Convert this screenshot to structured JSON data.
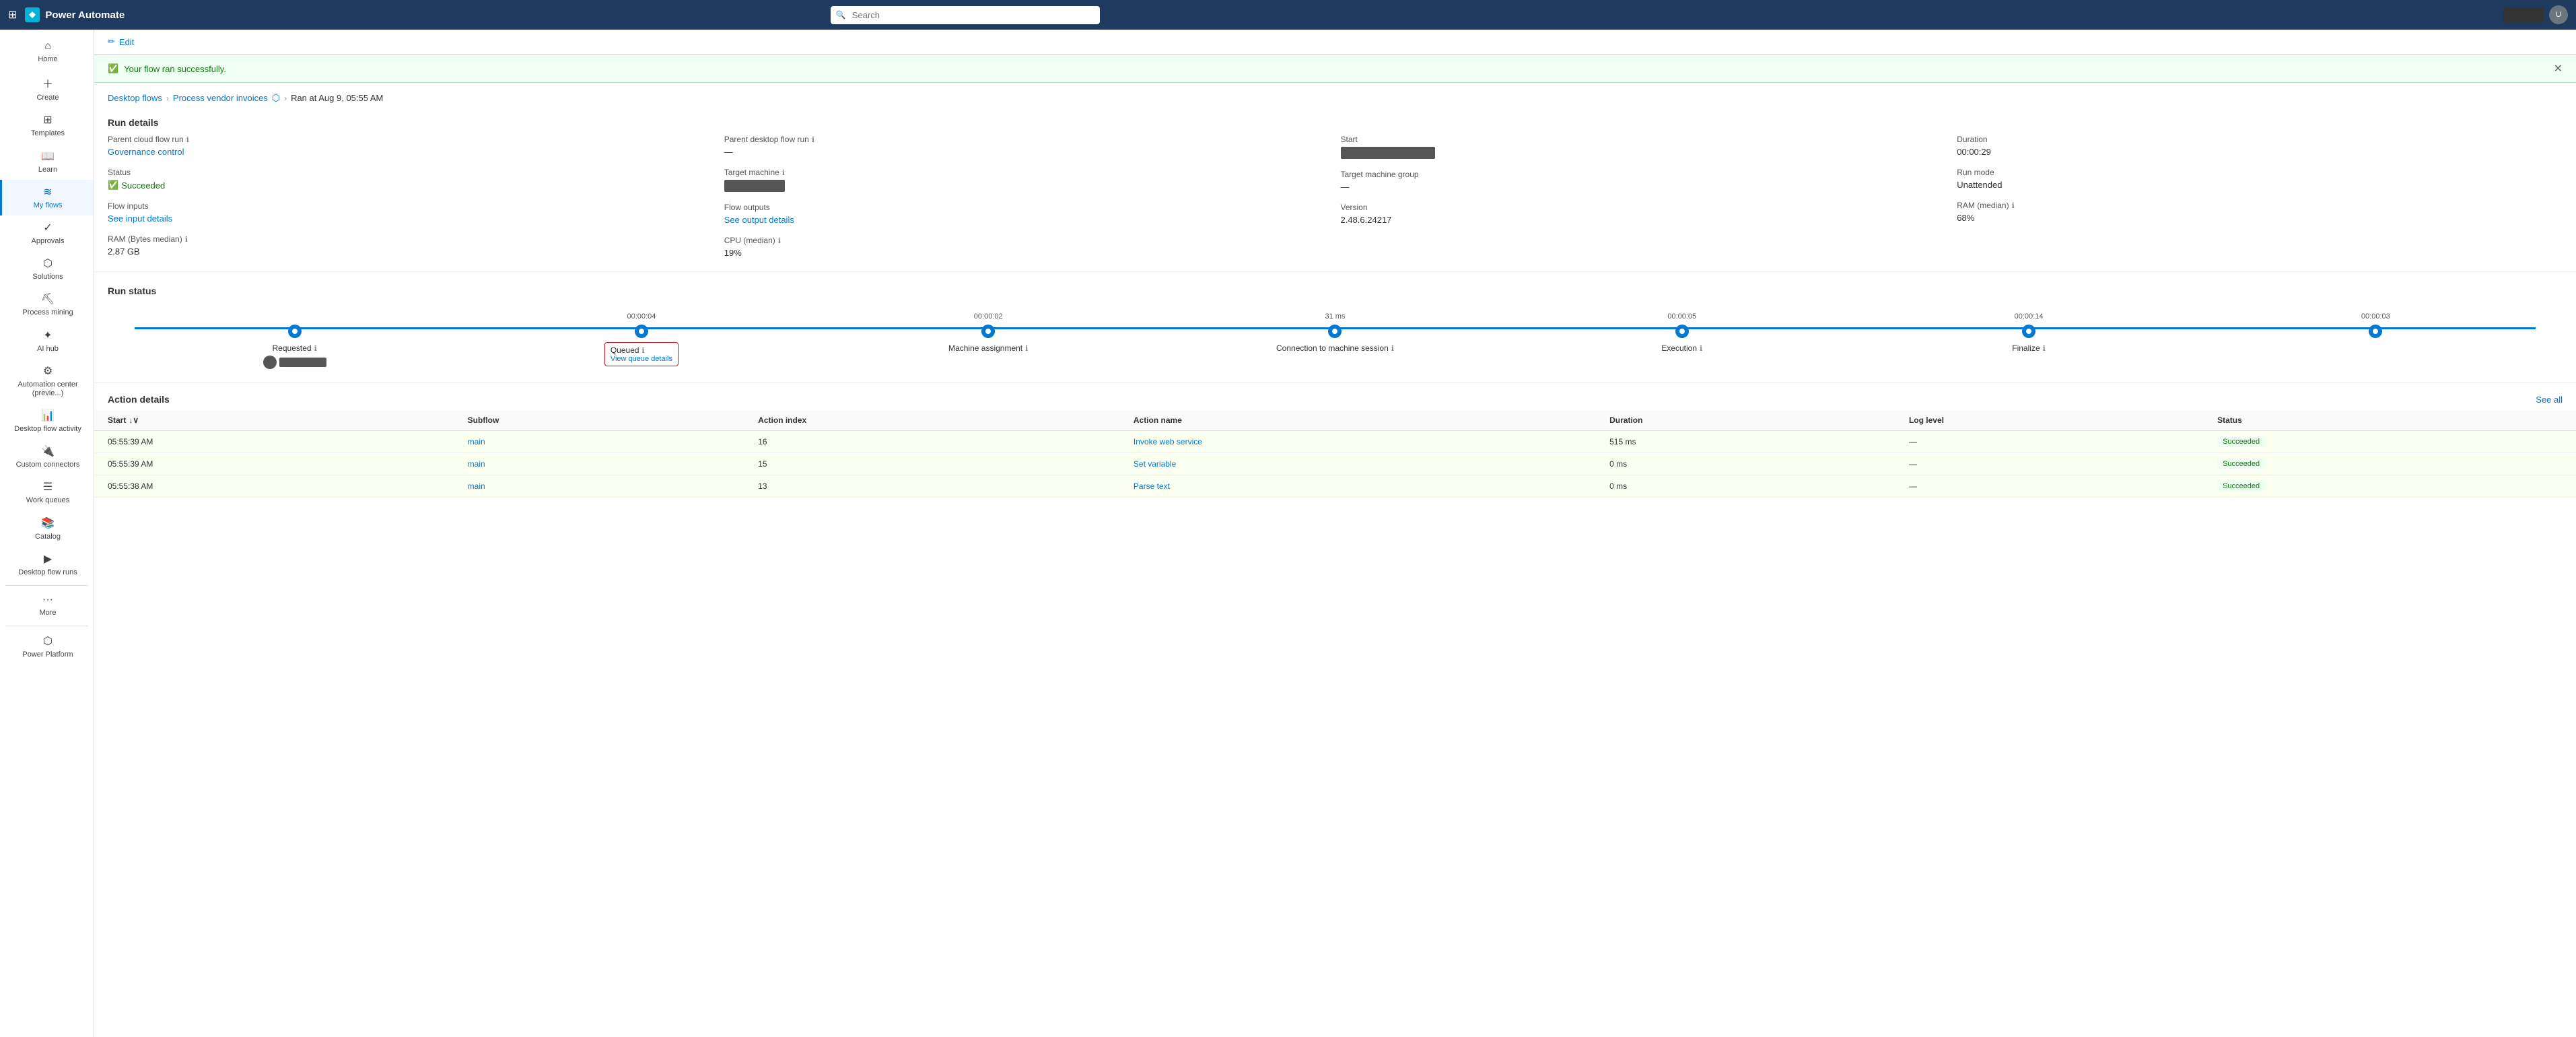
{
  "topbar": {
    "logo": "Power Automate",
    "search_placeholder": "Search"
  },
  "sidebar": {
    "items": [
      {
        "id": "home",
        "label": "Home",
        "icon": "⌂"
      },
      {
        "id": "create",
        "label": "Create",
        "icon": "+"
      },
      {
        "id": "templates",
        "label": "Templates",
        "icon": "⊞"
      },
      {
        "id": "learn",
        "label": "Learn",
        "icon": "📖"
      },
      {
        "id": "my-flows",
        "label": "My flows",
        "icon": "≋",
        "active": true
      },
      {
        "id": "approvals",
        "label": "Approvals",
        "icon": "✓"
      },
      {
        "id": "solutions",
        "label": "Solutions",
        "icon": "⬡"
      },
      {
        "id": "process-mining",
        "label": "Process mining",
        "icon": "⛏"
      },
      {
        "id": "ai-hub",
        "label": "AI hub",
        "icon": "✦"
      },
      {
        "id": "automation-center",
        "label": "Automation center (previe...)",
        "icon": "⚙"
      },
      {
        "id": "desktop-flow-activity",
        "label": "Desktop flow activity",
        "icon": "📊"
      },
      {
        "id": "custom-connectors",
        "label": "Custom connectors",
        "icon": "🔌"
      },
      {
        "id": "work-queues",
        "label": "Work queues",
        "icon": "☰"
      },
      {
        "id": "catalog",
        "label": "Catalog",
        "icon": "📚"
      },
      {
        "id": "desktop-flow-runs",
        "label": "Desktop flow runs",
        "icon": "▶"
      },
      {
        "id": "more",
        "label": "More",
        "icon": "···"
      },
      {
        "id": "power-platform",
        "label": "Power Platform",
        "icon": "⬡"
      }
    ]
  },
  "edit_button": "Edit",
  "success_banner": "Your flow ran successfully.",
  "breadcrumb": {
    "desktop_flows": "Desktop flows",
    "flow_name": "Process vendor invoices",
    "ran_at": "Ran at Aug 9, 05:55 AM"
  },
  "run_details_title": "Run details",
  "details": {
    "parent_cloud_flow_run_label": "Parent cloud flow run",
    "parent_cloud_flow_run_link": "Governance control",
    "parent_desktop_flow_run_label": "Parent desktop flow run",
    "parent_desktop_flow_run_value": "—",
    "start_label": "Start",
    "duration_label": "Duration",
    "duration_value": "00:00:29",
    "status_label": "Status",
    "status_value": "Succeeded",
    "target_machine_label": "Target machine",
    "target_machine_group_label": "Target machine group",
    "target_machine_group_value": "—",
    "run_mode_label": "Run mode",
    "run_mode_value": "Unattended",
    "flow_inputs_label": "Flow inputs",
    "flow_inputs_link": "See input details",
    "flow_outputs_label": "Flow outputs",
    "flow_outputs_link": "See output details",
    "version_label": "Version",
    "version_value": "2.48.6.24217",
    "ram_median_label": "RAM (median)",
    "ram_median_value": "68%",
    "ram_bytes_median_label": "RAM (Bytes median)",
    "ram_bytes_median_value": "2.87 GB",
    "cpu_median_label": "CPU (median)",
    "cpu_median_value": "19%"
  },
  "run_status_title": "Run status",
  "timeline": {
    "nodes": [
      {
        "id": "requested",
        "time": "",
        "label": "Requested",
        "has_info": true
      },
      {
        "id": "queued",
        "time": "00:00:04",
        "label": "Queued",
        "sublabel": "View queue details",
        "has_info": true
      },
      {
        "id": "machine-assignment",
        "time": "00:00:02",
        "label": "Machine assignment",
        "has_info": true
      },
      {
        "id": "connection",
        "time": "31 ms",
        "label": "Connection to machine session",
        "has_info": true
      },
      {
        "id": "execution",
        "time": "00:00:05",
        "label": "Execution",
        "has_info": true
      },
      {
        "id": "finalize",
        "time": "00:00:14",
        "label": "Finalize",
        "has_info": true
      },
      {
        "id": "end",
        "time": "00:00:03",
        "label": "",
        "has_info": false
      }
    ]
  },
  "action_details_title": "Action details",
  "see_all_label": "See all",
  "table": {
    "columns": [
      "Start",
      "Subflow",
      "Action index",
      "Action name",
      "Duration",
      "Log level",
      "Status"
    ],
    "rows": [
      {
        "start": "05:55:39 AM",
        "subflow": "main",
        "action_index": "16",
        "action_name": "Invoke web service",
        "duration": "515 ms",
        "log_level": "—",
        "status": "Succeeded"
      },
      {
        "start": "05:55:39 AM",
        "subflow": "main",
        "action_index": "15",
        "action_name": "Set variable",
        "duration": "0 ms",
        "log_level": "—",
        "status": "Succeeded"
      },
      {
        "start": "05:55:38 AM",
        "subflow": "main",
        "action_index": "13",
        "action_name": "Parse text",
        "duration": "0 ms",
        "log_level": "—",
        "status": "Succeeded"
      }
    ]
  }
}
